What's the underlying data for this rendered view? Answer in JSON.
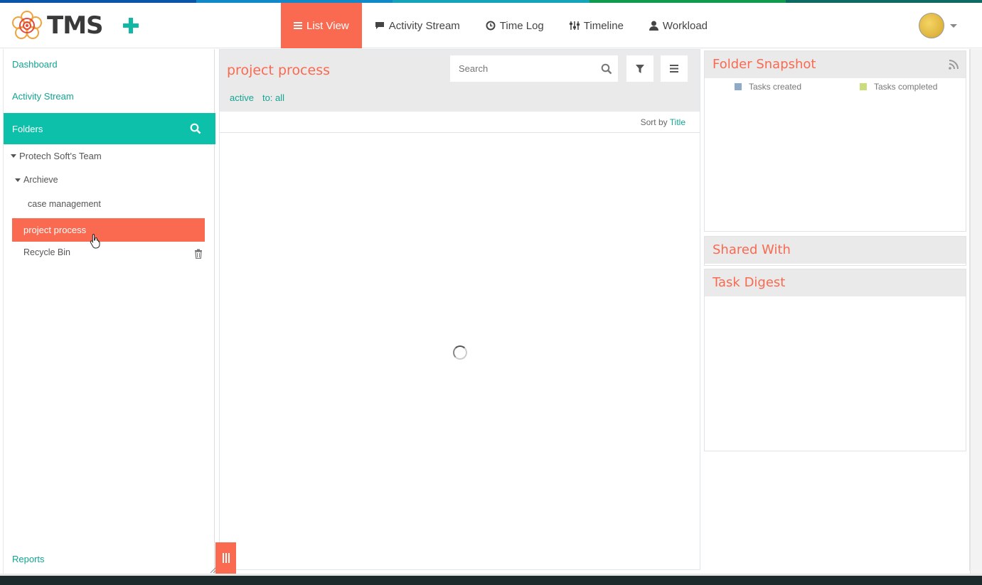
{
  "colors": {
    "accent": "#f96a51",
    "teal": "#0dc0aa",
    "link": "#12a592",
    "stripe": [
      "#0b55a8",
      "#1188c8",
      "#14a3b8",
      "#0f9a4d",
      "#0d6a63"
    ]
  },
  "app": {
    "logo_text": "TMS"
  },
  "header": {
    "nav": [
      {
        "label": "List View",
        "icon": "list-icon",
        "active": true
      },
      {
        "label": "Activity Stream",
        "icon": "comment-icon",
        "active": false
      },
      {
        "label": "Time Log",
        "icon": "clock-icon",
        "active": false
      },
      {
        "label": "Timeline",
        "icon": "sliders-icon",
        "active": false
      },
      {
        "label": "Workload",
        "icon": "user-icon",
        "active": false
      }
    ]
  },
  "sidebar": {
    "dashboard": "Dashboard",
    "activity_stream": "Activity Stream",
    "folders_label": "Folders",
    "team": "Protech Soft's Team",
    "archive": "Archieve",
    "case_management": "case management",
    "selected_folder": "project process",
    "recycle_bin": "Recycle Bin",
    "reports": "Reports"
  },
  "main": {
    "title": "project process",
    "search_placeholder": "Search",
    "filters": {
      "status": "active",
      "assignee": "to: all"
    },
    "sort_prefix": "Sort by",
    "sort_value": "Title"
  },
  "right": {
    "snapshot_title": "Folder Snapshot",
    "legend_created": "Tasks created",
    "legend_completed": "Tasks completed",
    "shared_title": "Shared With",
    "digest_title": "Task Digest"
  }
}
